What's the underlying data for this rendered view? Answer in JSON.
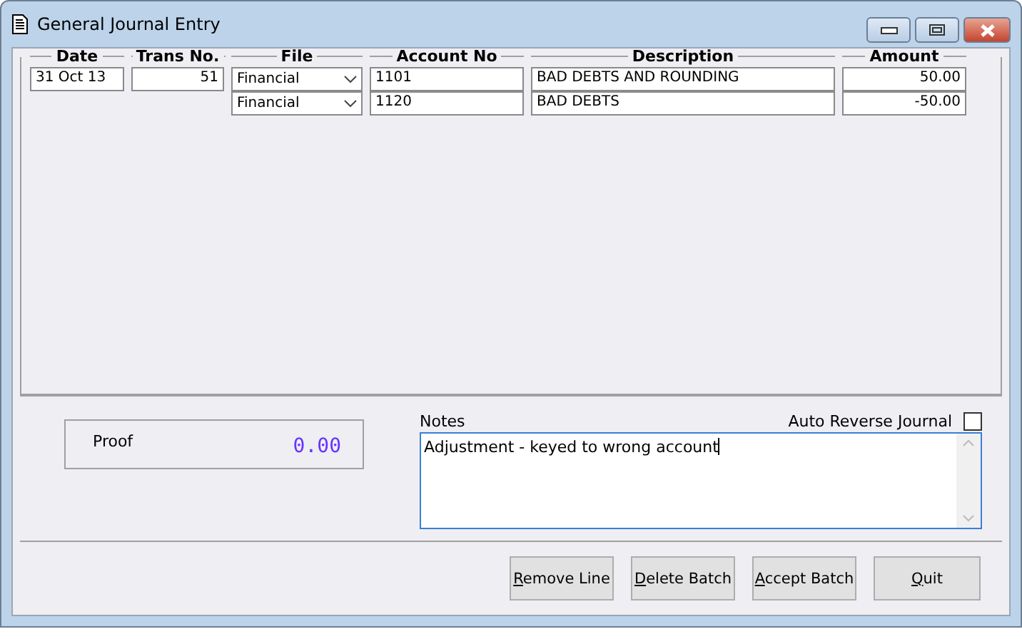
{
  "window": {
    "title": "General Journal Entry"
  },
  "table": {
    "columns": [
      "Date",
      "Trans No.",
      "File",
      "Account No",
      "Description",
      "Amount"
    ],
    "rows": [
      {
        "date": "31 Oct 13",
        "trans_no": "51",
        "file": "Financial",
        "account_no": "1101",
        "description": "BAD DEBTS AND ROUNDING",
        "amount": "50.00"
      },
      {
        "file": "Financial",
        "account_no": "1120",
        "description": "BAD DEBTS",
        "amount": "-50.00"
      }
    ]
  },
  "proof": {
    "label": "Proof",
    "value": "0.00"
  },
  "notes": {
    "label": "Notes",
    "value": "Adjustment - keyed to wrong account"
  },
  "auto_reverse": {
    "label": "Auto Reverse Journal",
    "checked": false
  },
  "buttons": [
    {
      "label": "Remove Line",
      "first_letter_underlined": true
    },
    {
      "label": "Delete Batch",
      "first_letter_underlined": true
    },
    {
      "label": "Accept Batch",
      "first_letter_underlined": true
    },
    {
      "label": "Quit",
      "first_letter_underlined": true
    }
  ]
}
